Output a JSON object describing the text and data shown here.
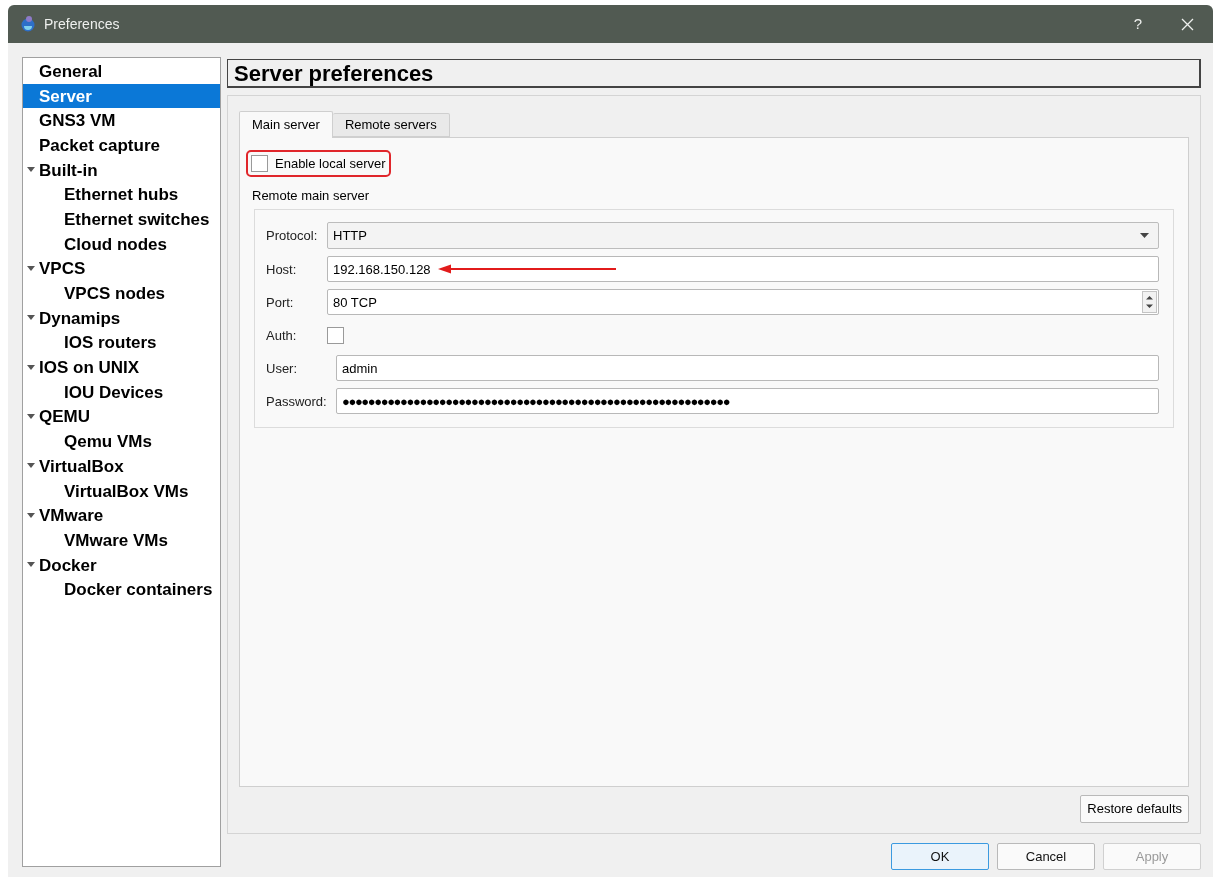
{
  "window": {
    "title": "Preferences",
    "help_button": "?"
  },
  "sidebar": {
    "items": [
      {
        "label": "General",
        "selected": false
      },
      {
        "label": "Server",
        "selected": true
      },
      {
        "label": "GNS3 VM",
        "selected": false
      },
      {
        "label": "Packet capture",
        "selected": false
      },
      {
        "label": "Built-in",
        "selected": false,
        "expanded": true,
        "children": [
          {
            "label": "Ethernet hubs",
            "selected": false
          },
          {
            "label": "Ethernet switches",
            "selected": false
          },
          {
            "label": "Cloud nodes",
            "selected": false
          }
        ]
      },
      {
        "label": "VPCS",
        "selected": false,
        "expanded": true,
        "children": [
          {
            "label": "VPCS nodes",
            "selected": false
          }
        ]
      },
      {
        "label": "Dynamips",
        "selected": false,
        "expanded": true,
        "children": [
          {
            "label": "IOS routers",
            "selected": false
          }
        ]
      },
      {
        "label": "IOS on UNIX",
        "selected": false,
        "expanded": true,
        "children": [
          {
            "label": "IOU Devices",
            "selected": false
          }
        ]
      },
      {
        "label": "QEMU",
        "selected": false,
        "expanded": true,
        "children": [
          {
            "label": "Qemu VMs",
            "selected": false
          }
        ]
      },
      {
        "label": "VirtualBox",
        "selected": false,
        "expanded": true,
        "children": [
          {
            "label": "VirtualBox VMs",
            "selected": false
          }
        ]
      },
      {
        "label": "VMware",
        "selected": false,
        "expanded": true,
        "children": [
          {
            "label": "VMware VMs",
            "selected": false
          }
        ]
      },
      {
        "label": "Docker",
        "selected": false,
        "expanded": true,
        "children": [
          {
            "label": "Docker containers",
            "selected": false
          }
        ]
      }
    ]
  },
  "header": {
    "title": "Server preferences"
  },
  "tabs": [
    {
      "label": "Main server",
      "selected": true
    },
    {
      "label": "Remote servers",
      "selected": false
    }
  ],
  "enable_local_server": {
    "label": "Enable local server",
    "checked": false
  },
  "group": {
    "title": "Remote main server",
    "fields": [
      {
        "kind": "dropdown",
        "label": "Protocol:",
        "value": "HTTP"
      },
      {
        "kind": "text",
        "label": "Host:",
        "value": "192.168.150.128"
      },
      {
        "kind": "spinbox",
        "label": "Port:",
        "value": "80 TCP"
      },
      {
        "kind": "checkbox",
        "label": "Auth:",
        "checked": false
      },
      {
        "kind": "text",
        "label": "User:",
        "value": "admin"
      },
      {
        "kind": "password",
        "label": "Password:",
        "value": "●●●●●●●●●●●●●●●●●●●●●●●●●●●●●●●●●●●●●●●●●●●●●●●●●●●●●●●●●●●●"
      }
    ]
  },
  "restore_defaults": "Restore defaults",
  "buttons": [
    {
      "label": "OK",
      "default": true,
      "disabled": false
    },
    {
      "label": "Cancel",
      "default": false,
      "disabled": false
    },
    {
      "label": "Apply",
      "default": false,
      "disabled": true
    }
  ]
}
